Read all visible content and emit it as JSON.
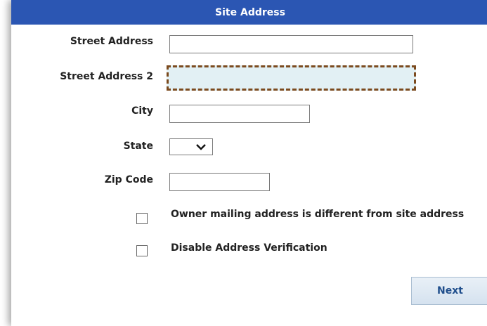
{
  "dialog": {
    "title": "Site Address"
  },
  "form": {
    "street_address": {
      "label": "Street Address",
      "value": ""
    },
    "street_address_2": {
      "label": "Street Address 2",
      "value": ""
    },
    "city": {
      "label": "City",
      "value": ""
    },
    "state": {
      "label": "State",
      "selected": ""
    },
    "zip": {
      "label": "Zip Code",
      "value": ""
    },
    "owner_mailing_different": {
      "label": "Owner mailing address is different from site address",
      "checked": false
    },
    "disable_verification": {
      "label": "Disable Address Verification",
      "checked": false
    }
  },
  "buttons": {
    "next_label": "Next"
  },
  "colors": {
    "frame": "#2b56b3",
    "focus_fill": "#e2f0f4",
    "focus_border": "#7b4a1e",
    "button_text": "#1f4e8c"
  }
}
